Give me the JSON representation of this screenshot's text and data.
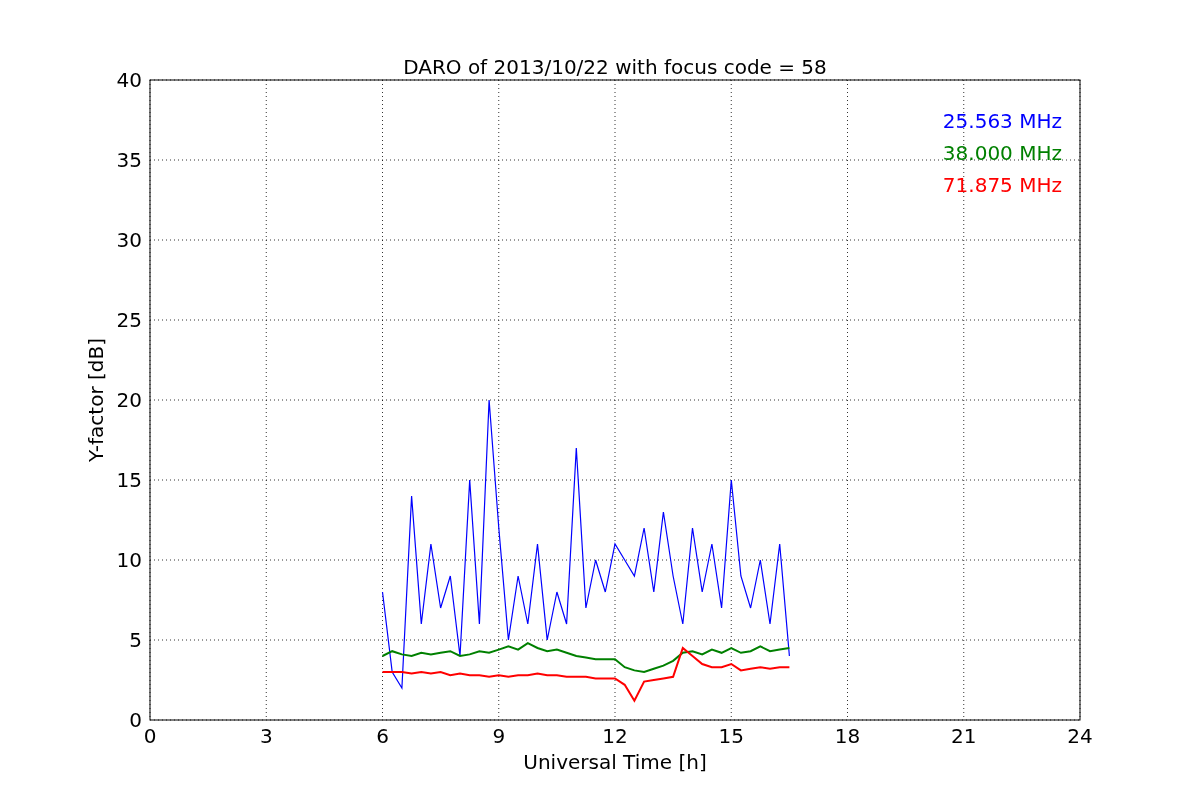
{
  "chart_data": {
    "type": "line",
    "title": "DARO of 2013/10/22 with focus code = 58",
    "xlabel": "Universal Time [h]",
    "ylabel": "Y-factor [dB]",
    "x": [
      6,
      6.25,
      6.5,
      6.75,
      7,
      7.25,
      7.5,
      7.75,
      8,
      8.25,
      8.5,
      8.75,
      9,
      9.25,
      9.5,
      9.75,
      10,
      10.25,
      10.5,
      10.75,
      11,
      11.25,
      11.5,
      11.75,
      12,
      12.25,
      12.5,
      12.75,
      13,
      13.25,
      13.5,
      13.75,
      14,
      14.25,
      14.5,
      14.75,
      15,
      15.25,
      15.5,
      15.75,
      16,
      16.25,
      16.5
    ],
    "series": [
      {
        "name": "25.563 MHz",
        "color": "#0000ff",
        "values": [
          8,
          3,
          2,
          14,
          6,
          11,
          7,
          9,
          4,
          15,
          6,
          20,
          12,
          5,
          9,
          6,
          11,
          5,
          8,
          6,
          17,
          7,
          10,
          8,
          11,
          10,
          9,
          12,
          8,
          13,
          9,
          6,
          12,
          8,
          11,
          7,
          15,
          9,
          7,
          10,
          6,
          11,
          4
        ]
      },
      {
        "name": "38.000 MHz",
        "color": "#008000",
        "values": [
          4,
          4.3,
          4.1,
          4,
          4.2,
          4.1,
          4.2,
          4.3,
          4,
          4.1,
          4.3,
          4.2,
          4.4,
          4.6,
          4.4,
          4.8,
          4.5,
          4.3,
          4.4,
          4.2,
          4,
          3.9,
          3.8,
          3.8,
          3.8,
          3.3,
          3.1,
          3,
          3.2,
          3.4,
          3.7,
          4.2,
          4.3,
          4.1,
          4.4,
          4.2,
          4.5,
          4.2,
          4.3,
          4.6,
          4.3,
          4.4,
          4.5
        ]
      },
      {
        "name": "71.875 MHz",
        "color": "#ff0000",
        "values": [
          3,
          3,
          3,
          2.9,
          3,
          2.9,
          3,
          2.8,
          2.9,
          2.8,
          2.8,
          2.7,
          2.8,
          2.7,
          2.8,
          2.8,
          2.9,
          2.8,
          2.8,
          2.7,
          2.7,
          2.7,
          2.6,
          2.6,
          2.6,
          2.2,
          1.2,
          2.4,
          2.5,
          2.6,
          2.7,
          4.5,
          4,
          3.5,
          3.3,
          3.3,
          3.5,
          3.1,
          3.2,
          3.3,
          3.2,
          3.3,
          3.3
        ]
      }
    ],
    "xlim": [
      0,
      24
    ],
    "ylim": [
      0,
      40
    ],
    "xticks": [
      0,
      3,
      6,
      9,
      12,
      15,
      18,
      21,
      24
    ],
    "yticks": [
      0,
      5,
      10,
      15,
      20,
      25,
      30,
      35,
      40
    ],
    "grid": true
  }
}
